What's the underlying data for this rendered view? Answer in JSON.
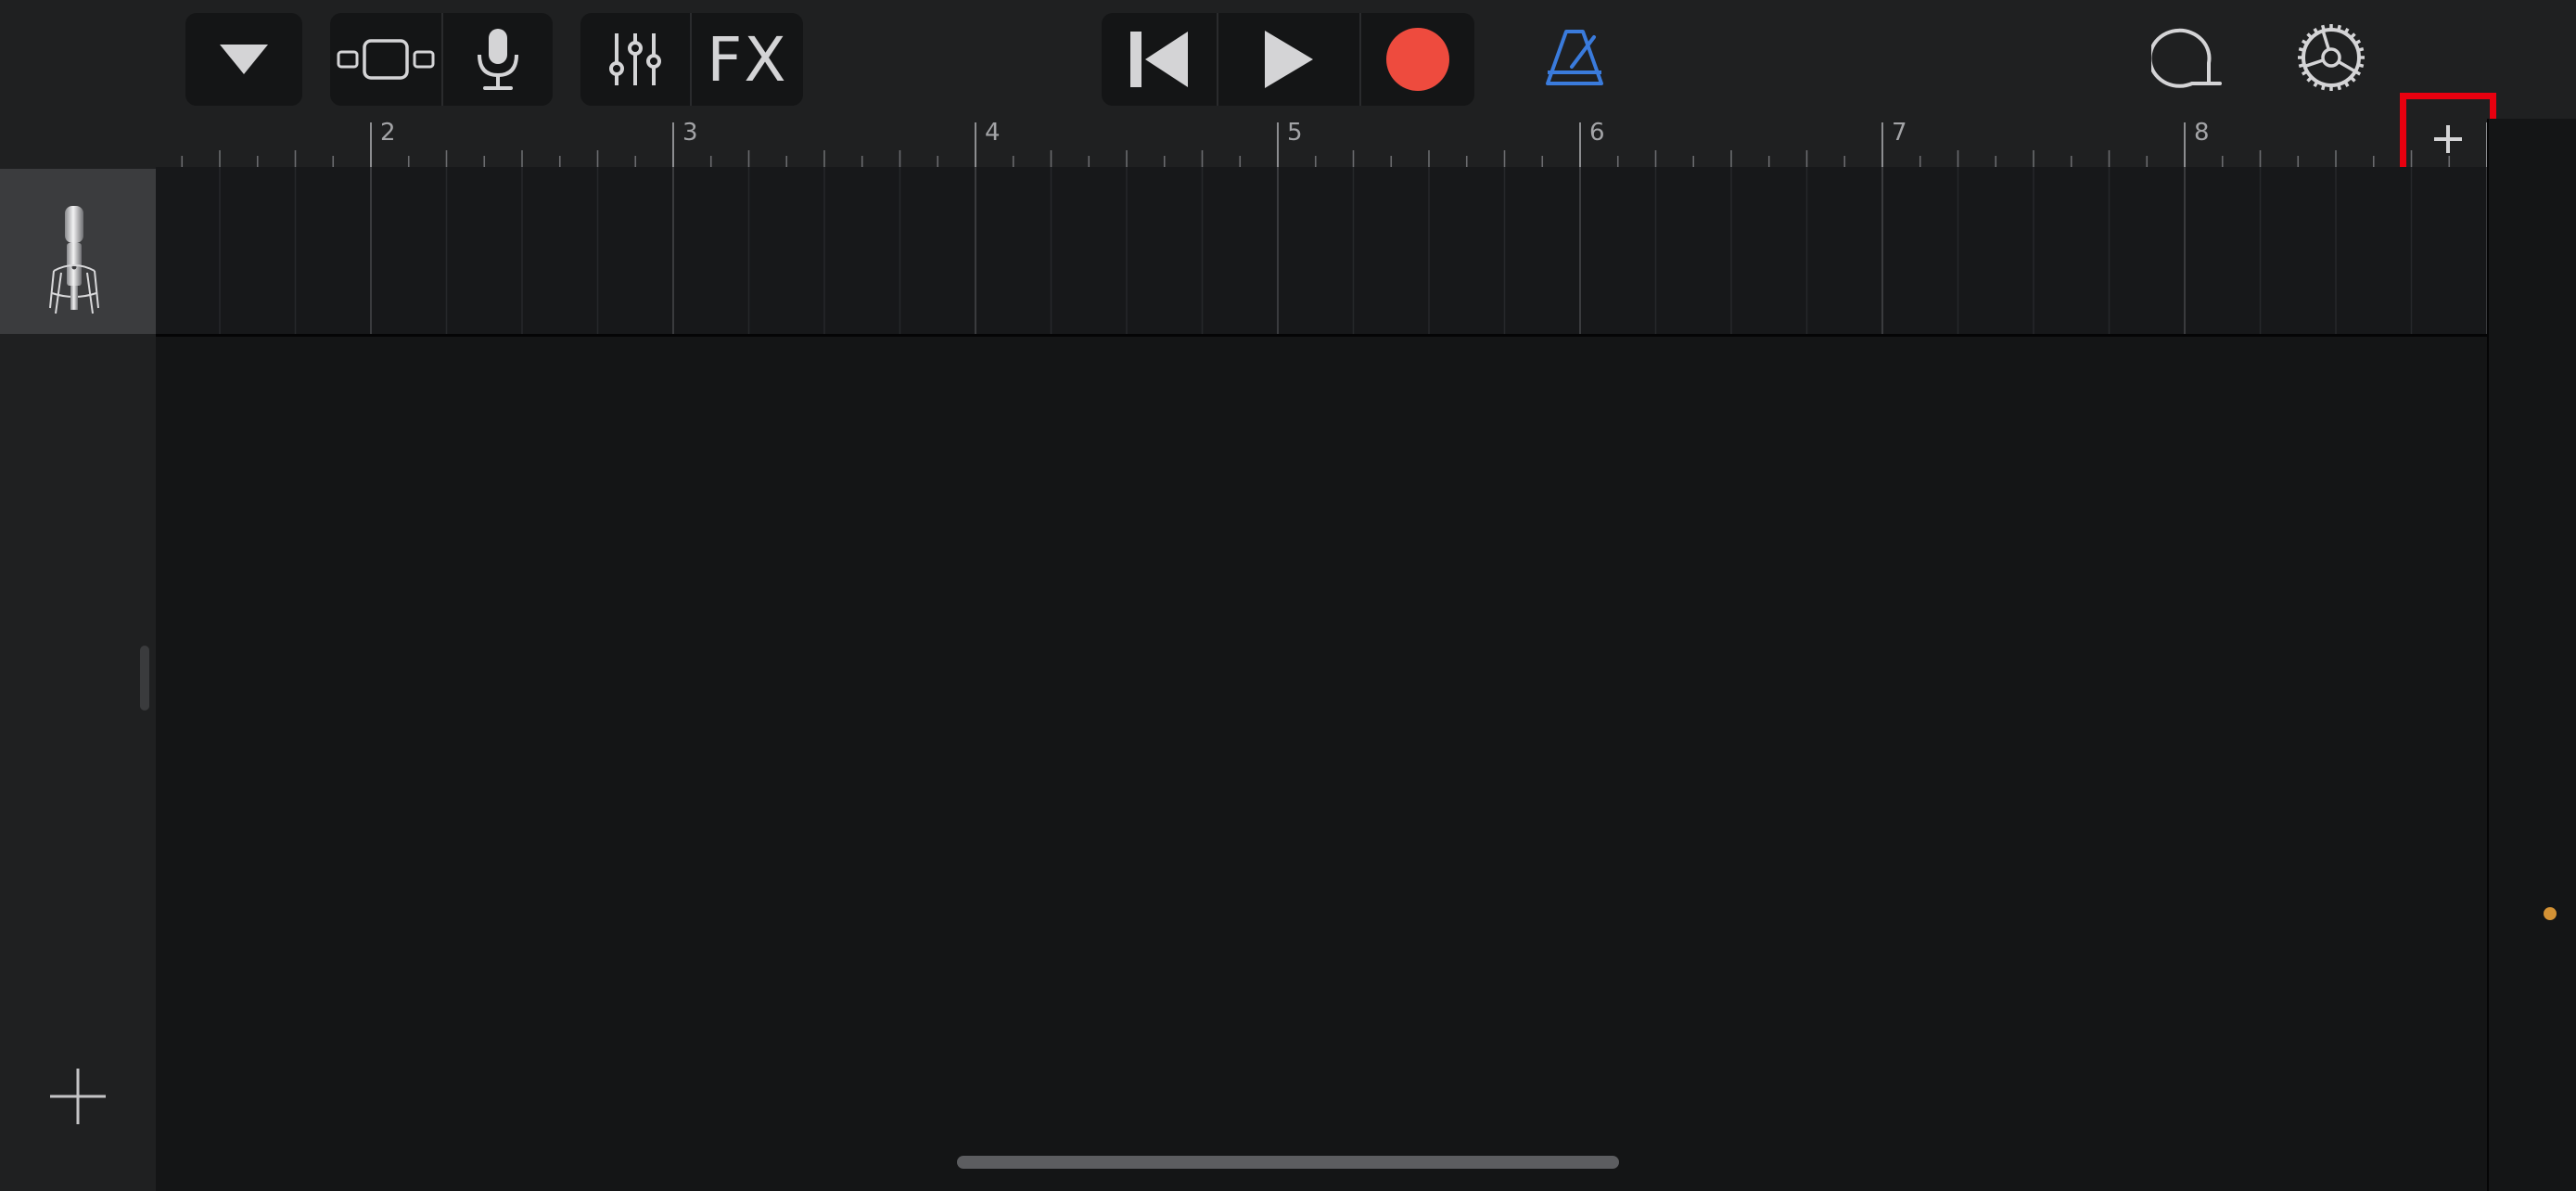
{
  "toolbar": {
    "browser_button_icon": "triangle-down-icon",
    "tracks_view_icon": "tracks-view-icon",
    "microphone_icon": "microphone-icon",
    "mixer_icon": "sliders-icon",
    "fx_label": "FX",
    "go_to_start_icon": "skip-back-icon",
    "play_icon": "play-icon",
    "record_icon": "record-icon",
    "metronome_icon": "metronome-icon",
    "loop_browser_icon": "loop-icon",
    "settings_icon": "gear-icon",
    "colors": {
      "record": "#ee4b3e",
      "metronome": "#3a7bdc",
      "highlight": "#e8000f",
      "playhead": "#d49235"
    }
  },
  "ruler": {
    "bars": [
      "2",
      "3",
      "4",
      "5",
      "6",
      "7",
      "8"
    ],
    "add_section_icon": "plus-icon"
  },
  "tracks": [
    {
      "instrument_icon": "condenser-microphone-icon"
    }
  ],
  "sidebar": {
    "add_track_icon": "plus-icon"
  }
}
